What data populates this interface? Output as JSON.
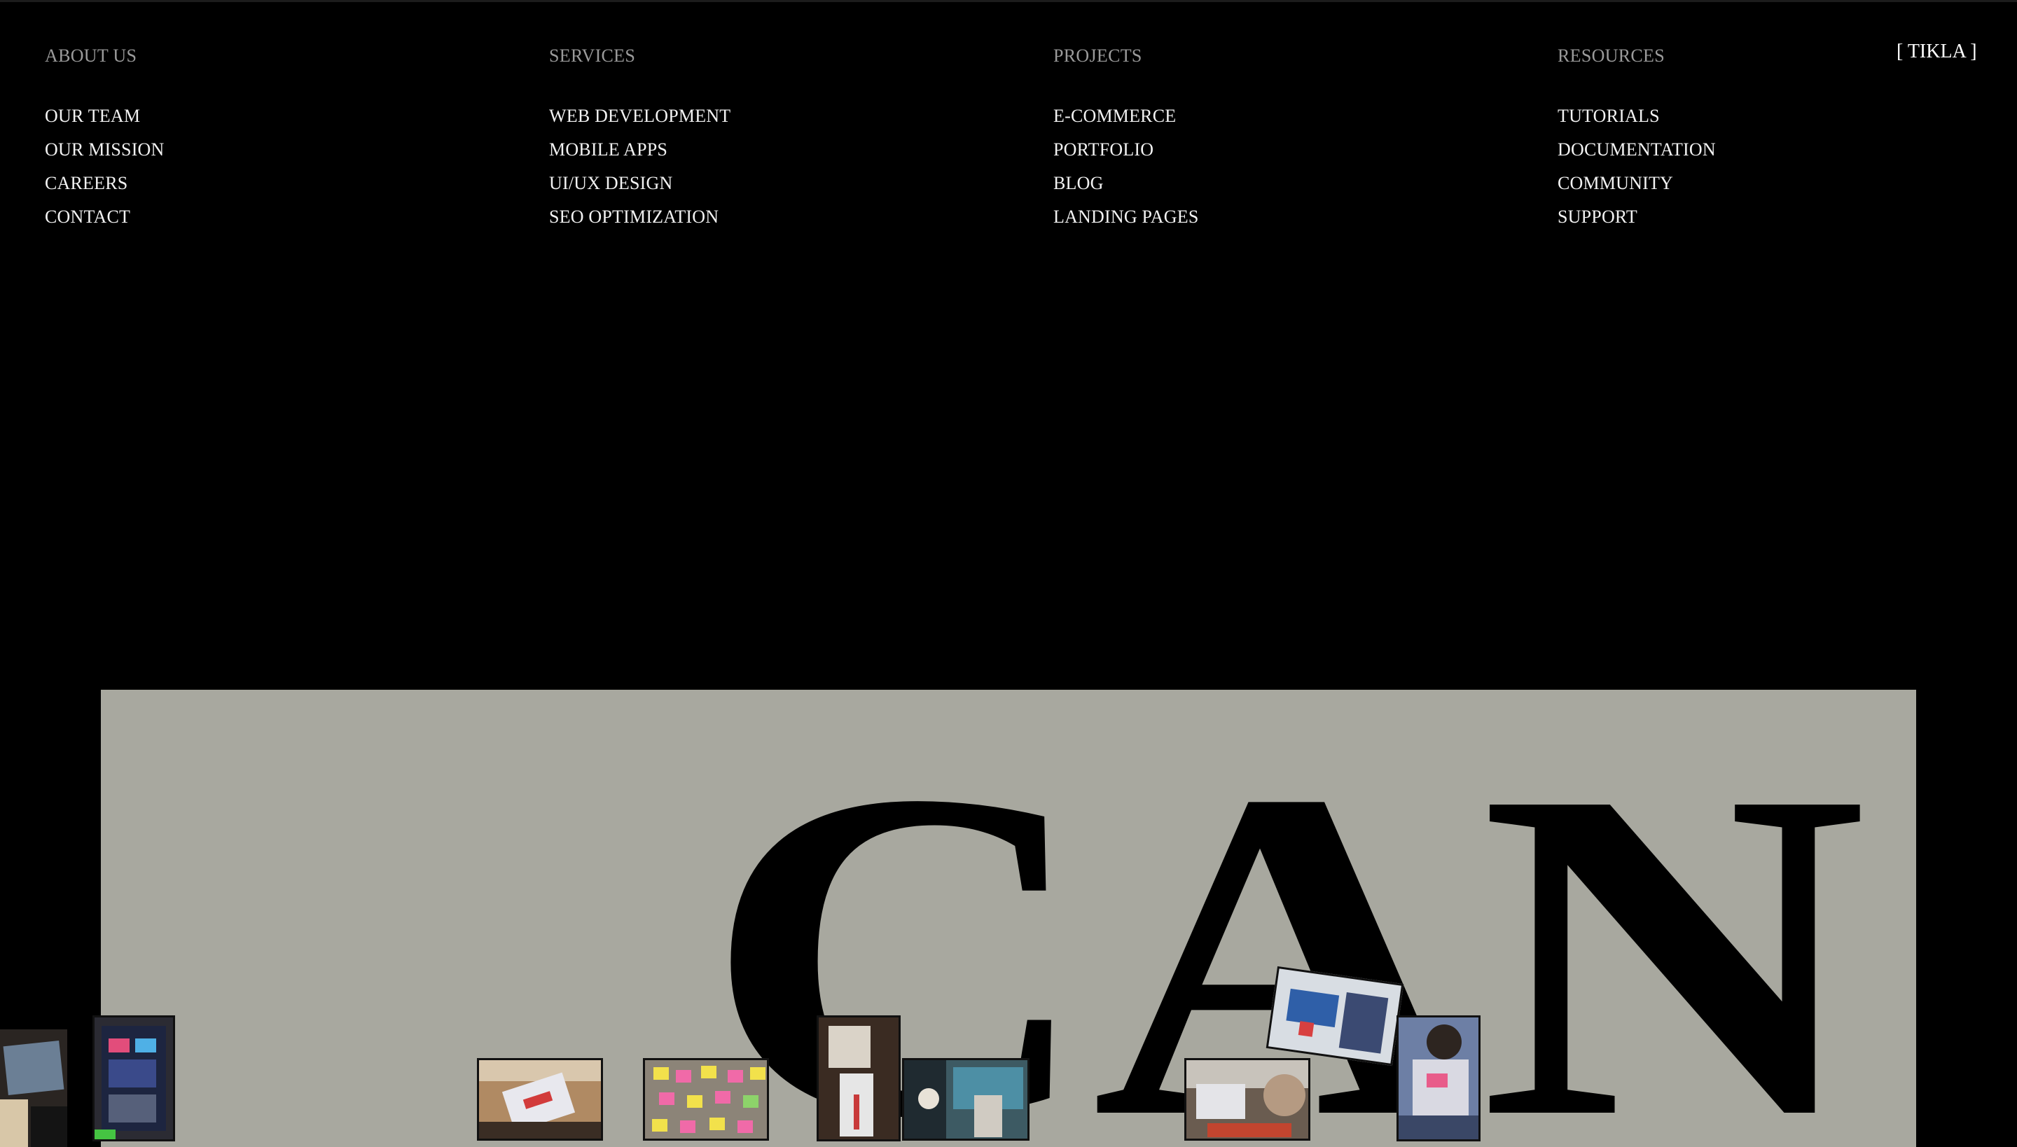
{
  "nav": {
    "columns": [
      {
        "heading": "ABOUT US",
        "items": [
          "OUR TEAM",
          "OUR MISSION",
          "CAREERS",
          "CONTACT"
        ]
      },
      {
        "heading": "SERVICES",
        "items": [
          "WEB DEVELOPMENT",
          "MOBILE APPS",
          "UI/UX DESIGN",
          "SEO OPTIMIZATION"
        ]
      },
      {
        "heading": "PROJECTS",
        "items": [
          "E-COMMERCE",
          "PORTFOLIO",
          "BLOG",
          "LANDING PAGES"
        ]
      },
      {
        "heading": "RESOURCES",
        "items": [
          "TUTORIALS",
          "DOCUMENTATION",
          "COMMUNITY",
          "SUPPORT"
        ]
      }
    ],
    "brand_button": "[ TIKLA ]"
  },
  "hero": {
    "headline": "CAN K"
  },
  "photos": [
    {
      "name": "photo-laptop-desk-dark"
    },
    {
      "name": "photo-monitor-screens"
    },
    {
      "name": "photo-tablet-on-desk"
    },
    {
      "name": "photo-sticky-note-board"
    },
    {
      "name": "photo-office-doorway"
    },
    {
      "name": "photo-team-meeting-teal"
    },
    {
      "name": "photo-laptop-on-table"
    },
    {
      "name": "photo-person-with-tablet"
    },
    {
      "name": "photo-person-with-laptop"
    }
  ],
  "colors": {
    "background": "#000000",
    "hero_background": "#a8a89f",
    "heading_text": "#9a9a9a",
    "link_text": "#f2f2f2"
  }
}
